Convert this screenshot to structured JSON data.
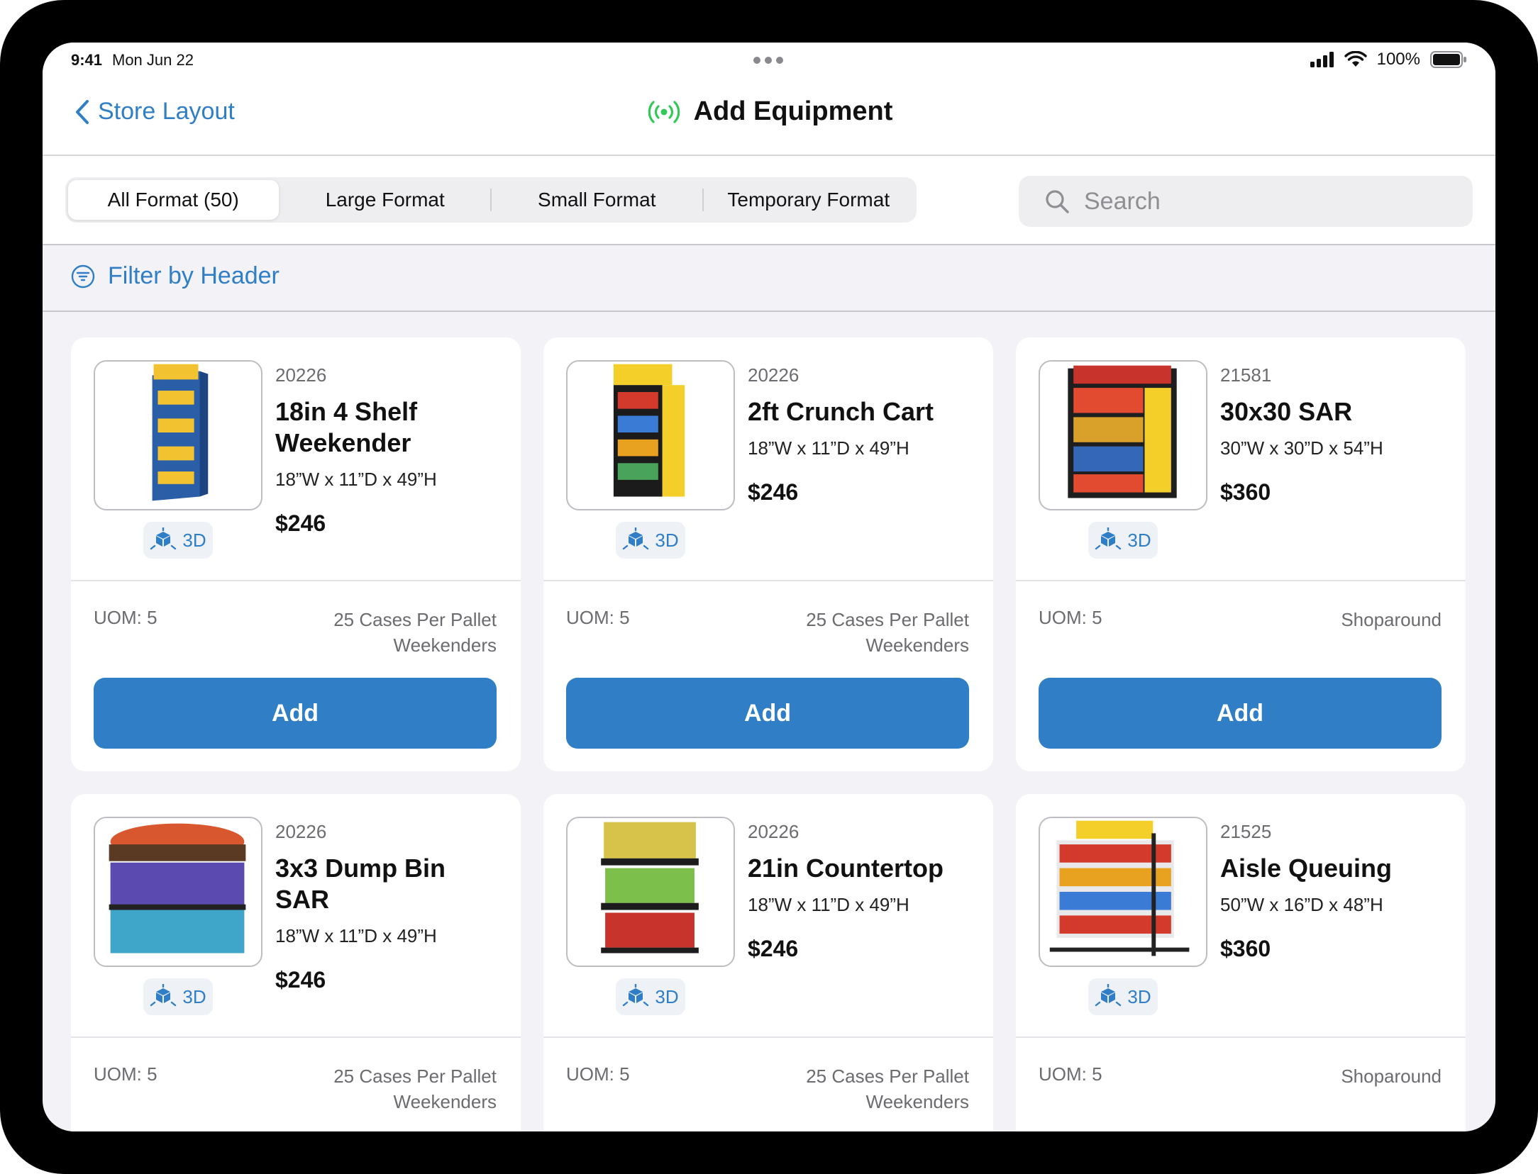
{
  "status_bar": {
    "time": "9:41",
    "date": "Mon Jun 22",
    "battery": "100%"
  },
  "nav": {
    "back_label": "Store Layout",
    "title": "Add Equipment"
  },
  "segments": [
    {
      "label": "All Format (50)",
      "active": true
    },
    {
      "label": "Large Format",
      "active": false
    },
    {
      "label": "Small Format",
      "active": false
    },
    {
      "label": "Temporary Format",
      "active": false
    }
  ],
  "search": {
    "placeholder": "Search",
    "value": ""
  },
  "filter": {
    "label": "Filter by Header"
  },
  "labels": {
    "three_d": "3D",
    "add": "Add"
  },
  "colors": {
    "accent": "#2f7ec6",
    "nav_icon": "#34c759",
    "background": "#f2f2f7"
  },
  "items": [
    {
      "code": "20226",
      "name": "18in 4 Shelf Weekender",
      "dims": "18”W x 11”D x 49”H",
      "price": "$246",
      "uom": "UOM: 5",
      "meta1": "25 Cases Per Pallet",
      "meta2": "Weekenders",
      "image": "weekender-display"
    },
    {
      "code": "20226",
      "name": "2ft Crunch Cart",
      "dims": "18”W x 11”D x 49”H",
      "price": "$246",
      "uom": "UOM: 5",
      "meta1": "25 Cases Per Pallet",
      "meta2": "Weekenders",
      "image": "crunch-cart-display"
    },
    {
      "code": "21581",
      "name": "30x30 SAR",
      "dims": "30”W x 30”D x 54”H",
      "price": "$360",
      "uom": "UOM: 5",
      "meta1": "Shoparound",
      "meta2": "",
      "image": "sar-display"
    },
    {
      "code": "20226",
      "name": "3x3 Dump Bin SAR",
      "dims": "18”W x 11”D x 49”H",
      "price": "$246",
      "uom": "UOM: 5",
      "meta1": "25 Cases Per Pallet",
      "meta2": "Weekenders",
      "image": "dump-bin-display"
    },
    {
      "code": "20226",
      "name": "21in Countertop",
      "dims": "18”W x 11”D x 49”H",
      "price": "$246",
      "uom": "UOM: 5",
      "meta1": "25 Cases Per Pallet",
      "meta2": "Weekenders",
      "image": "countertop-display"
    },
    {
      "code": "21525",
      "name": "Aisle Queuing",
      "dims": "50”W x 16”D x 48”H",
      "price": "$360",
      "uom": "UOM: 5",
      "meta1": "Shoparound",
      "meta2": "",
      "image": "aisle-queuing-display"
    }
  ]
}
